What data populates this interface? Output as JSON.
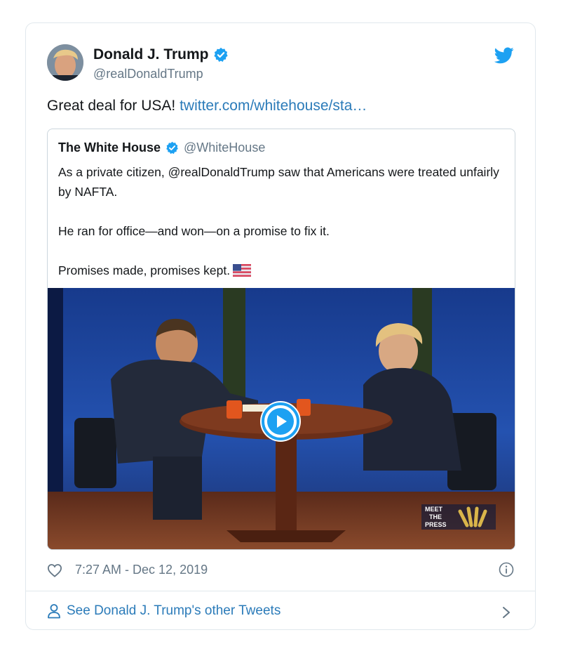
{
  "tweet": {
    "author_name": "Donald J. Trump",
    "author_handle": "@realDonaldTrump",
    "text_prefix": "Great deal for USA! ",
    "link_text": "twitter.com/whitehouse/sta…",
    "timestamp": "7:27 AM - Dec 12, 2019",
    "footer_link": "See Donald J. Trump's other Tweets"
  },
  "quoted_tweet": {
    "author_name": "The White House",
    "author_handle": "@WhiteHouse",
    "paragraphs": [
      "As a private citizen, @realDonaldTrump saw that Americans were treated unfairly by NAFTA.",
      "He ran for office—and won—on a promise to fix it.",
      "Promises made, promises kept."
    ],
    "video_watermark": [
      "MEET",
      "THE",
      "PRESS"
    ]
  },
  "icons": {
    "verified": "verified-badge-icon",
    "brand": "twitter-bird-icon",
    "like": "heart-icon",
    "info": "info-icon",
    "profile": "person-icon",
    "next": "chevron-right-icon",
    "flag": "us-flag-emoji",
    "play": "play-icon"
  },
  "colors": {
    "link": "#2b7bb9",
    "verified": "#1da1f2",
    "secondary_text": "#657786",
    "border": "#e1e8ed"
  }
}
